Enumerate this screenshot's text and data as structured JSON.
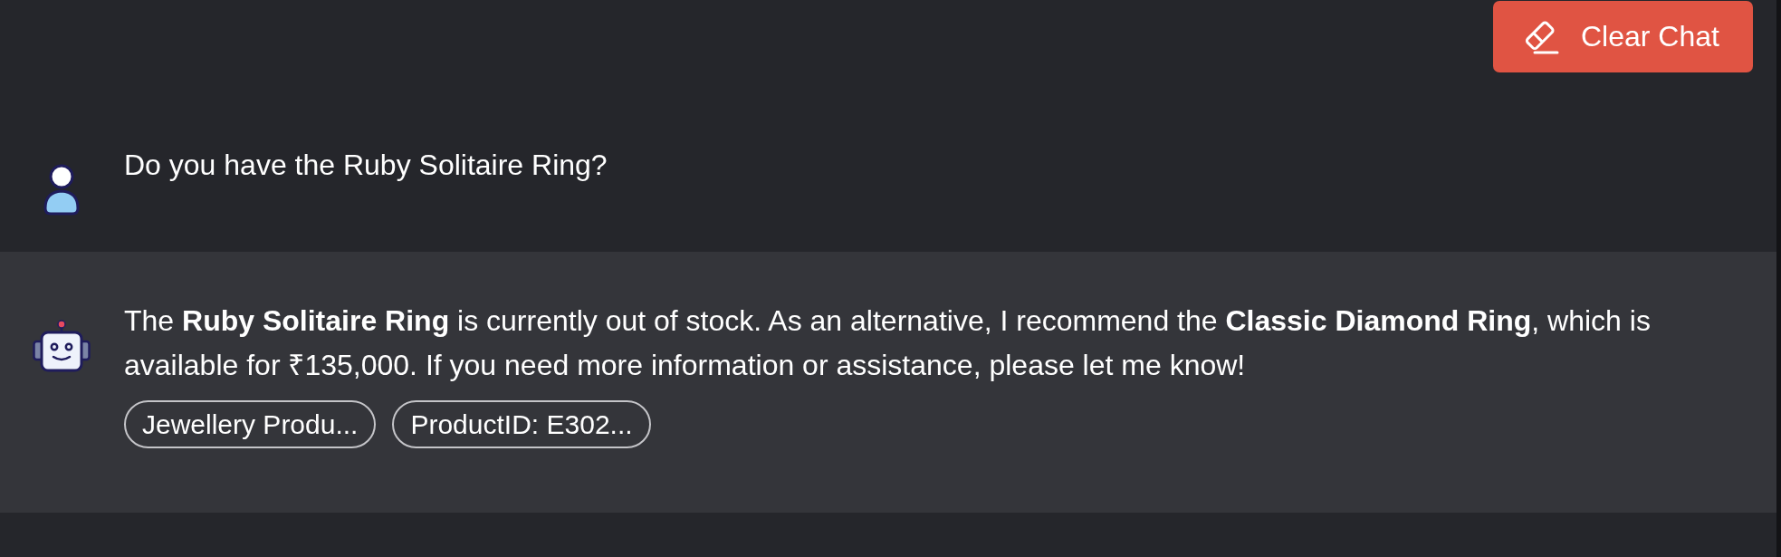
{
  "header": {
    "clear_button": {
      "label": "Clear Chat"
    }
  },
  "messages": [
    {
      "kind": "user",
      "text": "Do you have the Ruby Solitaire Ring?"
    },
    {
      "kind": "bot",
      "text": "The **Ruby Solitaire Ring** is currently out of stock. As an alternative, I recommend the **Classic Diamond Ring**, which is available for ₹135,000. If you need more information or assistance, please let me know!",
      "sources": [
        "Jewellery Produ...",
        "ProductID: E302..."
      ]
    }
  ]
}
